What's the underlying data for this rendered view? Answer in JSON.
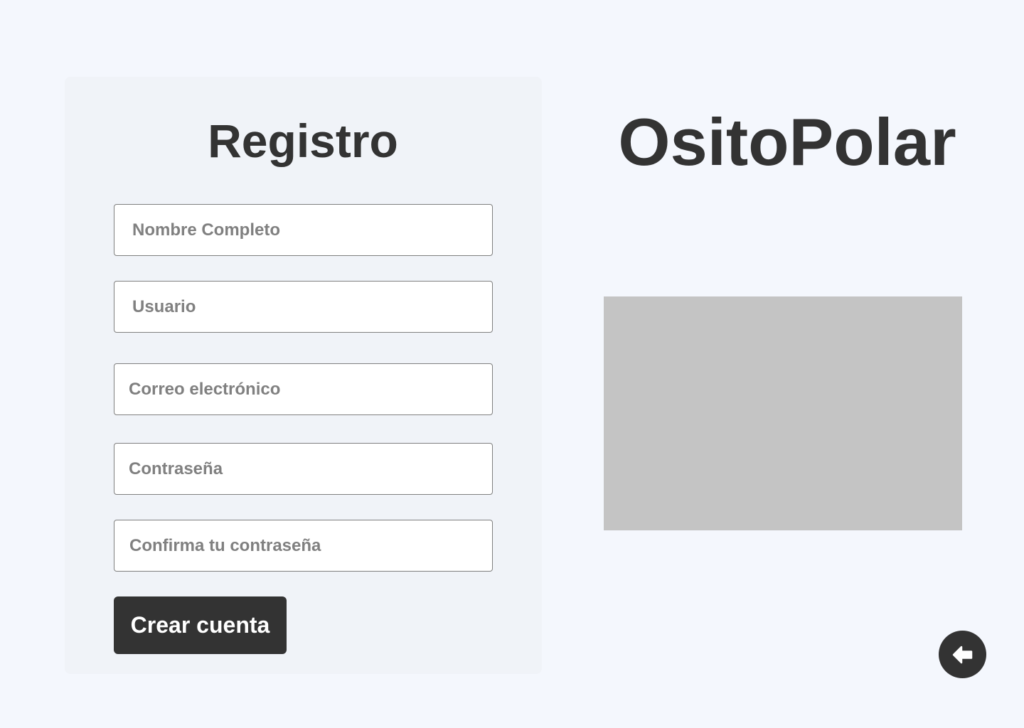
{
  "register_form": {
    "title": "Registro",
    "full_name_placeholder": "Nombre Completo",
    "username_placeholder": "Usuario",
    "email_placeholder": "Correo electrónico",
    "password_placeholder": "Contraseña",
    "confirm_password_placeholder": "Confirma tu contraseña",
    "submit_label": "Crear cuenta"
  },
  "brand": {
    "name": "OsitoPolar"
  },
  "back_button": {
    "icon": "arrow-left-icon"
  },
  "colors": {
    "background": "#f4f7fd",
    "panel": "#f0f3f8",
    "text_dark": "#333333",
    "placeholder_text": "#808080",
    "input_border": "#7f7f7f",
    "image_placeholder": "#c4c4c4",
    "button_bg": "#333333",
    "button_text": "#ffffff"
  }
}
